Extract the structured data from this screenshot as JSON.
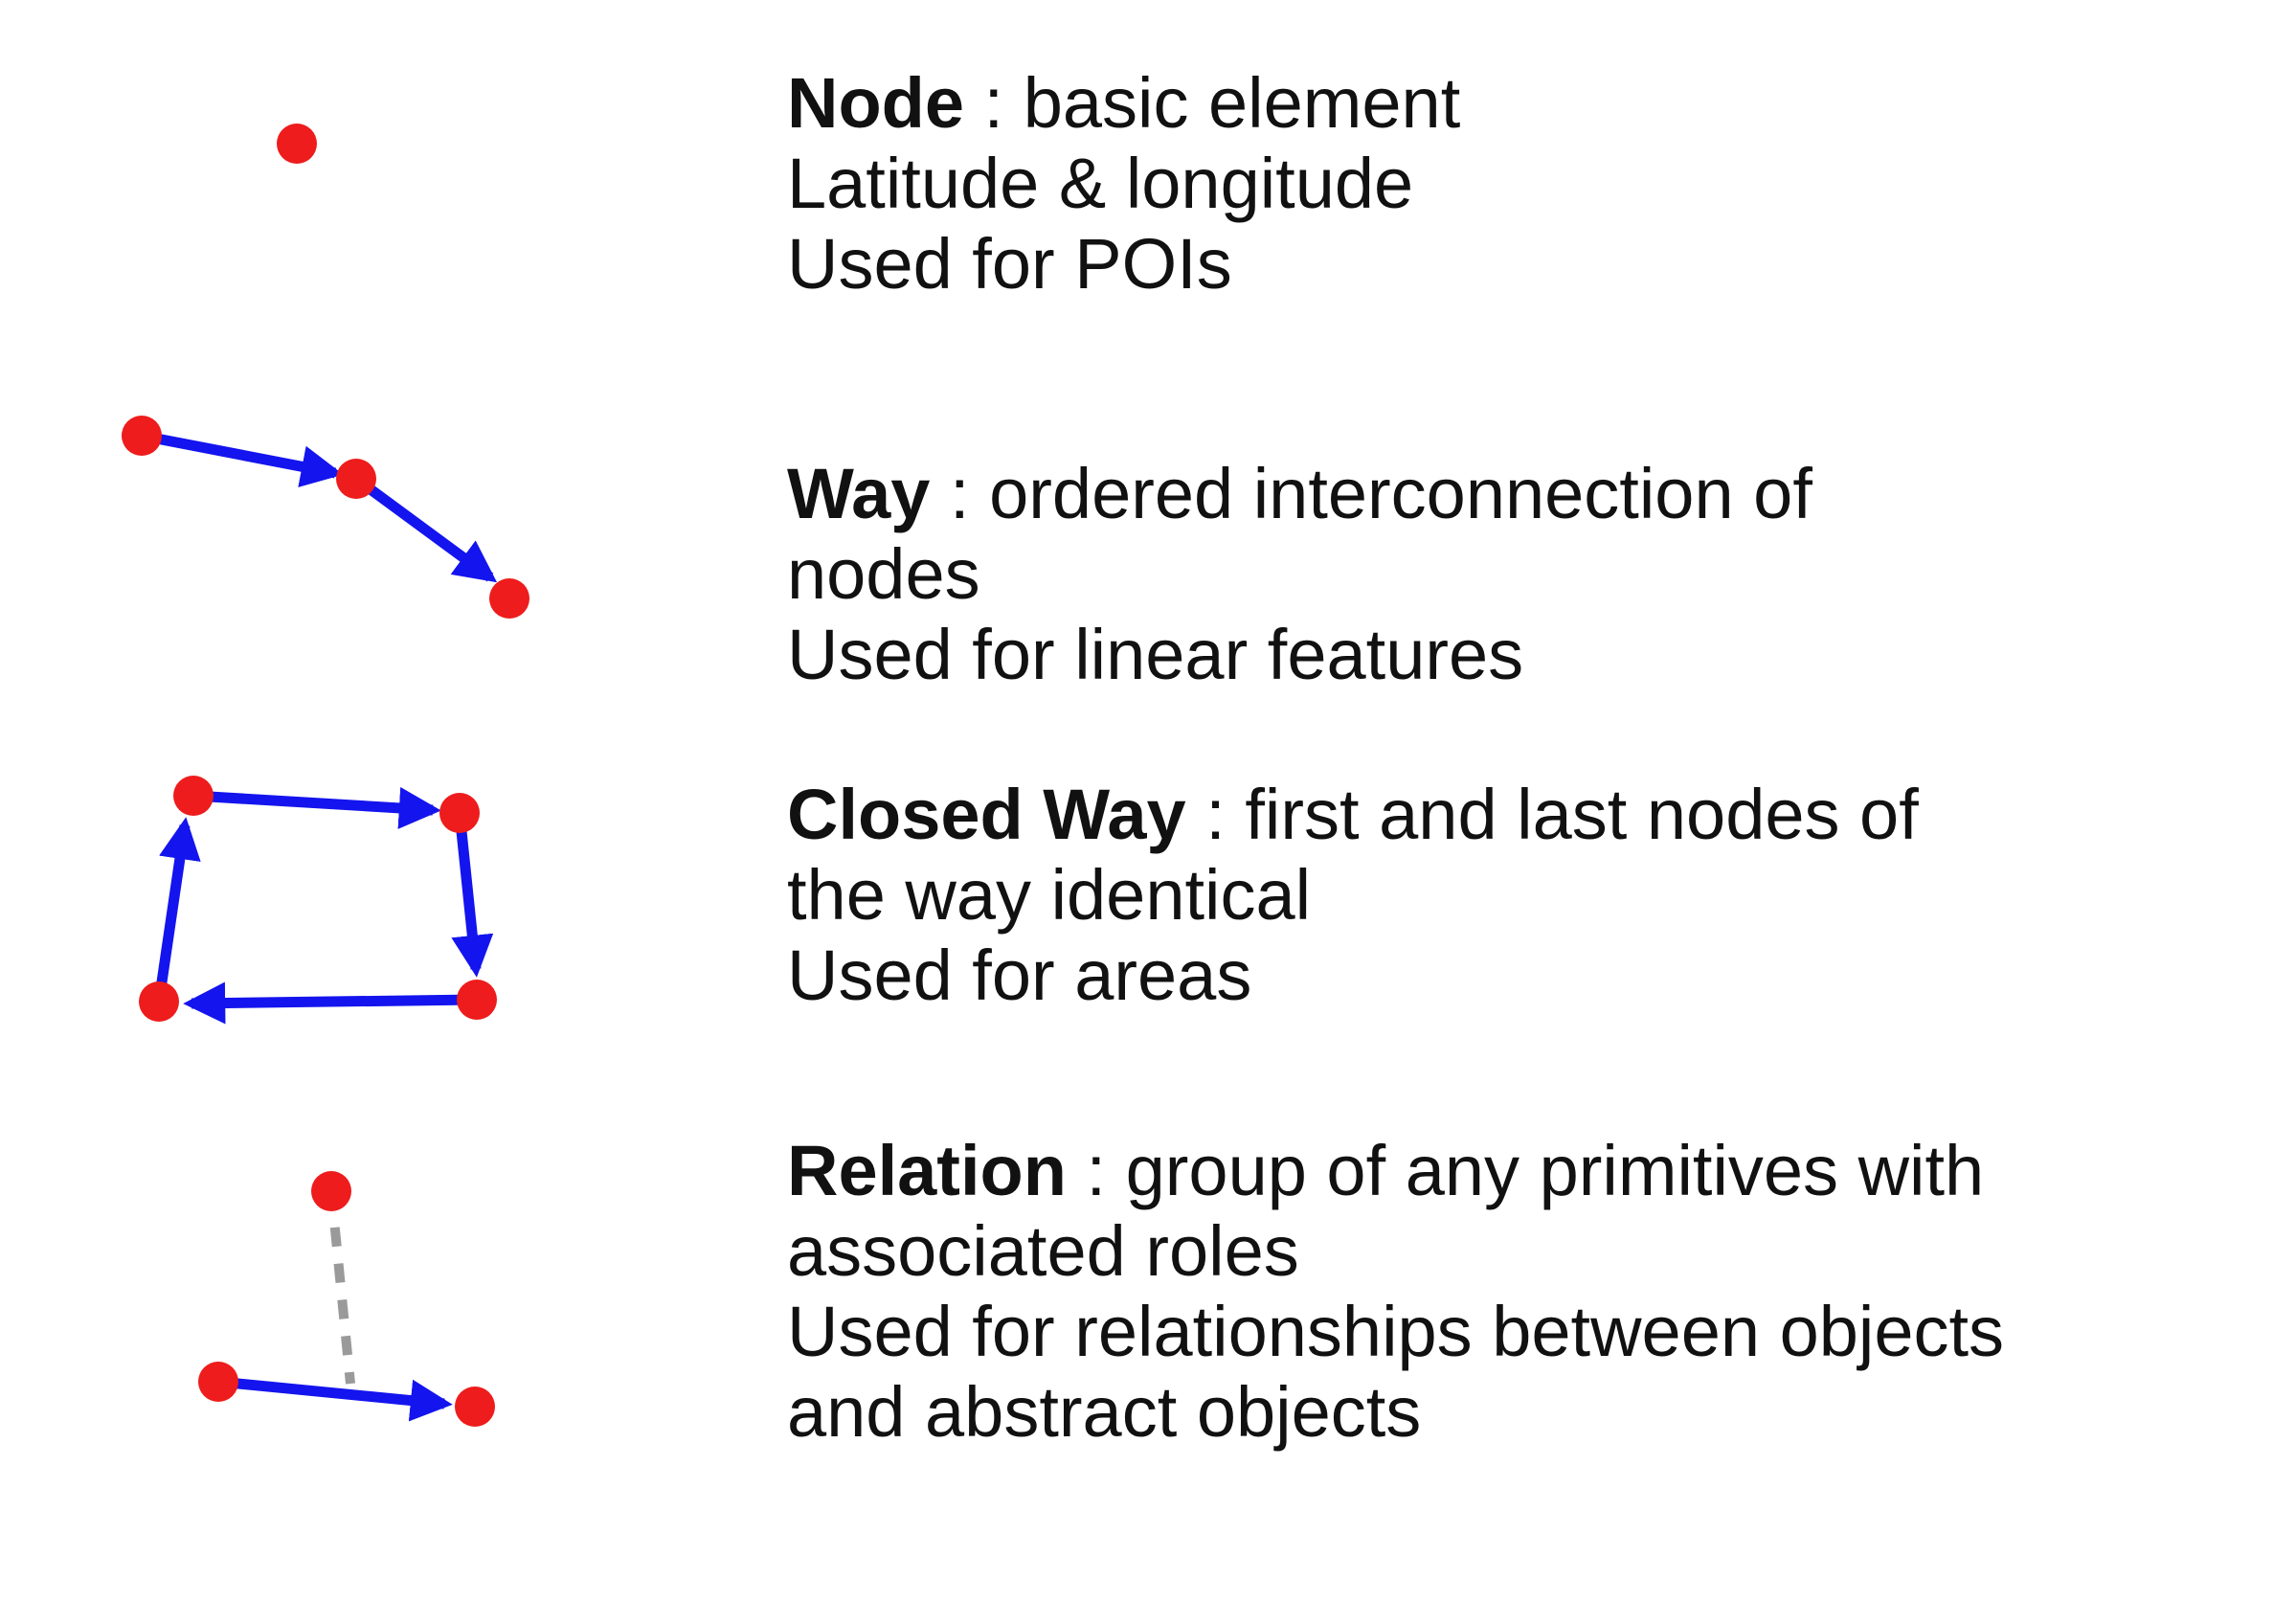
{
  "colors": {
    "node_fill": "#ee1c1c",
    "way_stroke": "#1414ee",
    "relation_member_stroke": "#9a9a9a",
    "text": "#111111",
    "background": "#ffffff"
  },
  "primitives": [
    {
      "id": "node",
      "icon": "single-node-icon",
      "term": "Node",
      "separator": " : ",
      "definition": "basic element",
      "lines": [
        "Latitude & longitude",
        "Used for POIs"
      ]
    },
    {
      "id": "way",
      "icon": "way-icon",
      "term": "Way",
      "separator": " : ",
      "definition": "ordered interconnection of",
      "lines": [
        "nodes",
        "Used for linear features"
      ]
    },
    {
      "id": "closed-way",
      "icon": "closed-way-icon",
      "term": "Closed Way",
      "separator": " : ",
      "definition": "first and last nodes of",
      "lines": [
        "the way identical",
        "Used for areas"
      ]
    },
    {
      "id": "relation",
      "icon": "relation-icon",
      "term": "Relation",
      "separator": " : ",
      "definition": "group of any primitives with",
      "lines": [
        "associated roles",
        "Used for relationships between objects",
        "and abstract objects"
      ]
    }
  ]
}
